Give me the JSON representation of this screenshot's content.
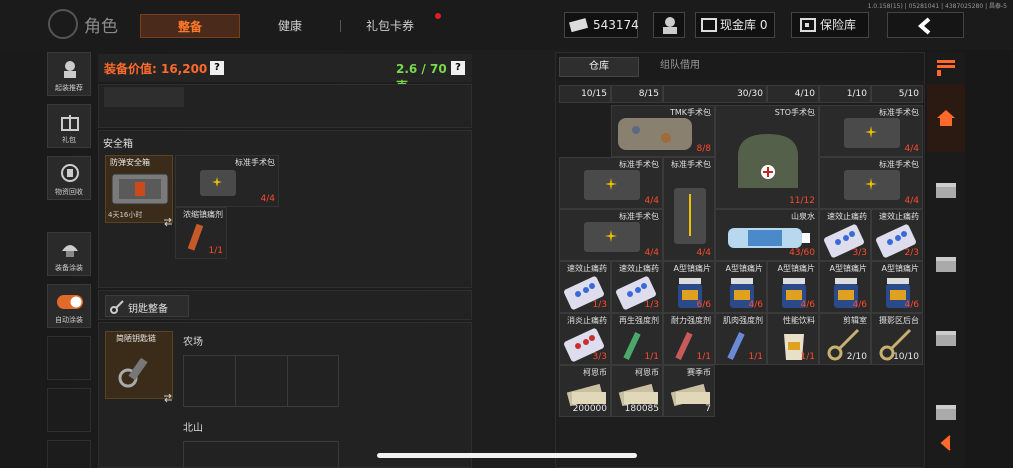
{
  "version": "1.0.158(15) | 05281041 | 4387025280 | 昌泰-5",
  "header": {
    "title": "角色",
    "tabs": [
      {
        "label": "整备",
        "active": true
      },
      {
        "label": "健康",
        "active": false
      },
      {
        "label": "礼包卡券",
        "active": false,
        "dot": true
      }
    ],
    "currency": "543174",
    "cash_vault": "现金库 0",
    "safe_vault": "保险库"
  },
  "sidebar": [
    {
      "label": "起装推荐",
      "icon": "character-icon"
    },
    {
      "label": "礼包",
      "icon": "gift-icon"
    },
    {
      "label": "物资回收",
      "icon": "recycle-icon"
    },
    {
      "label": "装备涂装",
      "icon": "helmet-icon"
    },
    {
      "label": "自动涂装",
      "icon": "toggle-icon"
    }
  ],
  "equip": {
    "value_label": "装备价值: 16,200",
    "weight_label": "2.6 / 70 千克",
    "safe_box_title": "安全箱",
    "safe_box": {
      "name": "防弹安全箱",
      "timer": "4天16小时"
    },
    "safe_items": [
      {
        "name": "标准手术包",
        "count": "4/4"
      },
      {
        "name": "浓缩镇痛剂",
        "count": "1/1"
      }
    ],
    "key_title": "钥匙整备",
    "key_item": {
      "name": "简陋钥匙链"
    },
    "key_maps": [
      "农场",
      "北山"
    ]
  },
  "warehouse": {
    "tabs": [
      {
        "label": "仓库",
        "active": true
      },
      {
        "label": "组队借用",
        "active": false
      }
    ],
    "top_counts": [
      "10/15",
      "8/15",
      "30/30",
      "4/10",
      "1/10",
      "5/10"
    ],
    "items": [
      {
        "name": "TMK手术包",
        "count": "8/8",
        "red": true
      },
      {
        "name": "STO手术包",
        "count": "11/12",
        "red": true
      },
      {
        "name": "标准手术包",
        "count": "4/4",
        "red": true
      },
      {
        "name": "标准手术包",
        "count": "4/4",
        "red": true
      },
      {
        "name": "标准手术包",
        "count": "4/4",
        "red": true
      },
      {
        "name": "标准手术包",
        "count": "4/4",
        "red": true
      },
      {
        "name": "标准手术包",
        "count": "4/4",
        "red": true
      },
      {
        "name": "山泉水",
        "count": "43/60",
        "red": true
      },
      {
        "name": "速效止痛药",
        "count": "3/3",
        "red": true
      },
      {
        "name": "速效止痛药",
        "count": "2/3",
        "red": true
      },
      {
        "name": "速效止痛药",
        "count": "1/3",
        "red": true
      },
      {
        "name": "速效止痛药",
        "count": "1/3",
        "red": true
      },
      {
        "name": "A型镇痛片",
        "count": "6/6",
        "red": true
      },
      {
        "name": "A型镇痛片",
        "count": "4/6",
        "red": true
      },
      {
        "name": "A型镇痛片",
        "count": "4/6",
        "red": true
      },
      {
        "name": "A型镇痛片",
        "count": "4/6",
        "red": true
      },
      {
        "name": "A型镇痛片",
        "count": "4/6",
        "red": true
      },
      {
        "name": "消炎止痛药",
        "count": "3/3",
        "red": true
      },
      {
        "name": "再生强度剂",
        "count": "1/1",
        "red": true
      },
      {
        "name": "耐力强度剂",
        "count": "1/1",
        "red": true
      },
      {
        "name": "肌肉强度剂",
        "count": "1/1",
        "red": true
      },
      {
        "name": "性能饮料",
        "count": "1/1",
        "red": true
      },
      {
        "name": "剪辑室",
        "count": "2/10",
        "red": false
      },
      {
        "name": "摄影区后台",
        "count": "10/10",
        "red": false
      },
      {
        "name": "柯恩币",
        "count": "200000",
        "red": false
      },
      {
        "name": "柯恩币",
        "count": "180085",
        "red": false
      },
      {
        "name": "赛季币",
        "count": "7",
        "red": false
      }
    ]
  },
  "colors": {
    "accent": "#ff7a2a",
    "count_red": "#ff4a2a",
    "weight_green": "#7ad84a",
    "value_orange": "#ff6a2a"
  }
}
